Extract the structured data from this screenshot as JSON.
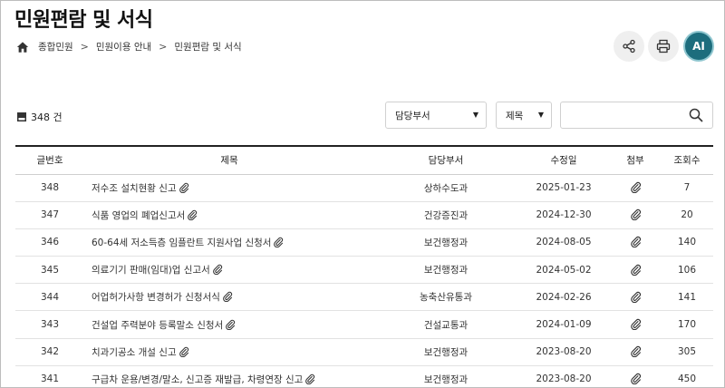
{
  "page": {
    "title": "민원편람 및 서식"
  },
  "breadcrumb": {
    "items": [
      "종합민원",
      "민원이용 안내",
      "민원편람 및 서식"
    ]
  },
  "actions": {
    "ai_label": "AI"
  },
  "summary": {
    "count_label": "348 건"
  },
  "filters": {
    "dept_select": "담당부서",
    "field_select": "제목",
    "search_value": ""
  },
  "table": {
    "headers": [
      "글번호",
      "제목",
      "담당부서",
      "수정일",
      "첨부",
      "조회수"
    ],
    "rows": [
      {
        "no": "348",
        "title": "저수조 설치현황 신고",
        "dept": "상하수도과",
        "date": "2025-01-23",
        "views": "7"
      },
      {
        "no": "347",
        "title": "식품 영업의 폐업신고서",
        "dept": "건강증진과",
        "date": "2024-12-30",
        "views": "20"
      },
      {
        "no": "346",
        "title": "60-64세 저소득층 임플란트 지원사업 신청서",
        "dept": "보건행정과",
        "date": "2024-08-05",
        "views": "140"
      },
      {
        "no": "345",
        "title": "의료기기 판매(임대)업 신고서",
        "dept": "보건행정과",
        "date": "2024-05-02",
        "views": "106"
      },
      {
        "no": "344",
        "title": "어업허가사항 변경허가 신청서식",
        "dept": "농축산유통과",
        "date": "2024-02-26",
        "views": "141"
      },
      {
        "no": "343",
        "title": "건설업 주력분야 등록말소 신청서",
        "dept": "건설교통과",
        "date": "2024-01-09",
        "views": "170"
      },
      {
        "no": "342",
        "title": "치과기공소 개설 신고",
        "dept": "보건행정과",
        "date": "2023-08-20",
        "views": "305"
      },
      {
        "no": "341",
        "title": "구급차 운용/변경/말소, 신고증 재발급, 차령연장 신고",
        "dept": "보건행정과",
        "date": "2023-08-20",
        "views": "450"
      }
    ]
  },
  "icons": {
    "home": "home-icon",
    "share": "share-icon",
    "print": "printer-icon",
    "search": "search-icon",
    "attachment": "paperclip-icon",
    "document": "document-icon"
  },
  "colors": {
    "ai_accent": "#1d6d7d",
    "header_border": "#222222"
  }
}
